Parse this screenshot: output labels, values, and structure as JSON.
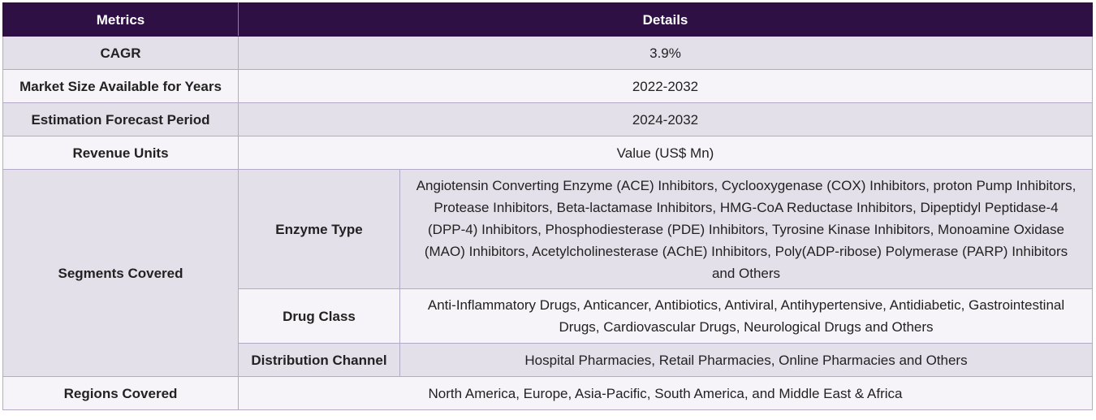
{
  "header": {
    "metrics": "Metrics",
    "details": "Details"
  },
  "rows": {
    "cagr": {
      "label": "CAGR",
      "value": "3.9%"
    },
    "market_size": {
      "label": "Market Size Available for Years",
      "value": "2022-2032"
    },
    "forecast": {
      "label": "Estimation Forecast Period",
      "value": "2024-2032"
    },
    "revenue": {
      "label": "Revenue Units",
      "value": "Value (US$ Mn)"
    },
    "segments": {
      "label": "Segments Covered",
      "enzyme_type": {
        "label": "Enzyme Type",
        "value": "Angiotensin Converting Enzyme (ACE) Inhibitors, Cyclooxygenase (COX) Inhibitors, proton Pump Inhibitors, Protease Inhibitors, Beta-lactamase Inhibitors, HMG-CoA Reductase Inhibitors, Dipeptidyl Peptidase-4 (DPP-4) Inhibitors, Phosphodiesterase (PDE) Inhibitors, Tyrosine Kinase Inhibitors, Monoamine Oxidase (MAO) Inhibitors, Acetylcholinesterase (AChE) Inhibitors, Poly(ADP-ribose) Polymerase (PARP) Inhibitors and Others"
      },
      "drug_class": {
        "label": "Drug Class",
        "value": "Anti-Inflammatory Drugs, Anticancer, Antibiotics, Antiviral, Antihypertensive, Antidiabetic, Gastrointestinal Drugs, Cardiovascular Drugs, Neurological Drugs and Others"
      },
      "distribution_channel": {
        "label": "Distribution Channel",
        "value": "Hospital Pharmacies, Retail Pharmacies, Online Pharmacies and Others"
      }
    },
    "regions": {
      "label": "Regions Covered",
      "value": "North America, Europe, Asia-Pacific, South America, and Middle East & Africa"
    }
  },
  "colors": {
    "header_bg": "#2e1044",
    "row_shaded": "#e4e0ea",
    "row_light": "#f6f4f8",
    "border": "#b4aac8"
  }
}
